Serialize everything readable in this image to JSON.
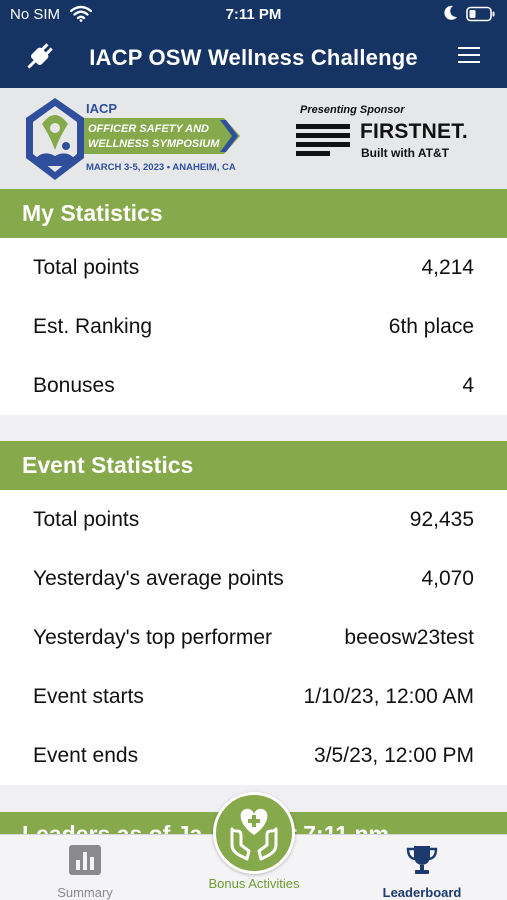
{
  "status_bar": {
    "carrier": "No SIM",
    "time": "7:11 PM"
  },
  "nav": {
    "title": "IACP OSW Wellness Challenge",
    "left_icon": "plug-icon",
    "right_icon": "hamburger-menu-icon"
  },
  "banner": {
    "iacp": "IACP",
    "symposium_line1": "OFFICER SAFETY AND",
    "symposium_line2": "WELLNESS SYMPOSIUM",
    "symposium_date": "MARCH 3-5, 2023 • ANAHEIM, CA",
    "sponsor_label": "Presenting Sponsor",
    "sponsor_name": "FIRSTNET.",
    "sponsor_tagline": "Built with AT&T"
  },
  "my_statistics": {
    "title": "My Statistics",
    "rows": [
      {
        "label": "Total points",
        "value": "4,214"
      },
      {
        "label": "Est. Ranking",
        "value": "6th place"
      },
      {
        "label": "Bonuses",
        "value": "4"
      }
    ]
  },
  "event_statistics": {
    "title": "Event Statistics",
    "rows": [
      {
        "label": "Total points",
        "value": "92,435"
      },
      {
        "label": "Yesterday's average points",
        "value": "4,070"
      },
      {
        "label": "Yesterday's top performer",
        "value": "beeosw23test"
      },
      {
        "label": "Event starts",
        "value": "1/10/23, 12:00 AM"
      },
      {
        "label": "Event ends",
        "value": "3/5/23, 12:00 PM"
      }
    ]
  },
  "leaders_banner": {
    "text": "Leaders as of Ja… 023 at 7:11 pm"
  },
  "tabbar": {
    "summary": "Summary",
    "bonus": "Bonus Activities",
    "leaderboard": "Leaderboard"
  },
  "colors": {
    "nav_bg": "#163463",
    "section_green": "#86a94b",
    "leaderboard_active": "#1d3a6e"
  }
}
